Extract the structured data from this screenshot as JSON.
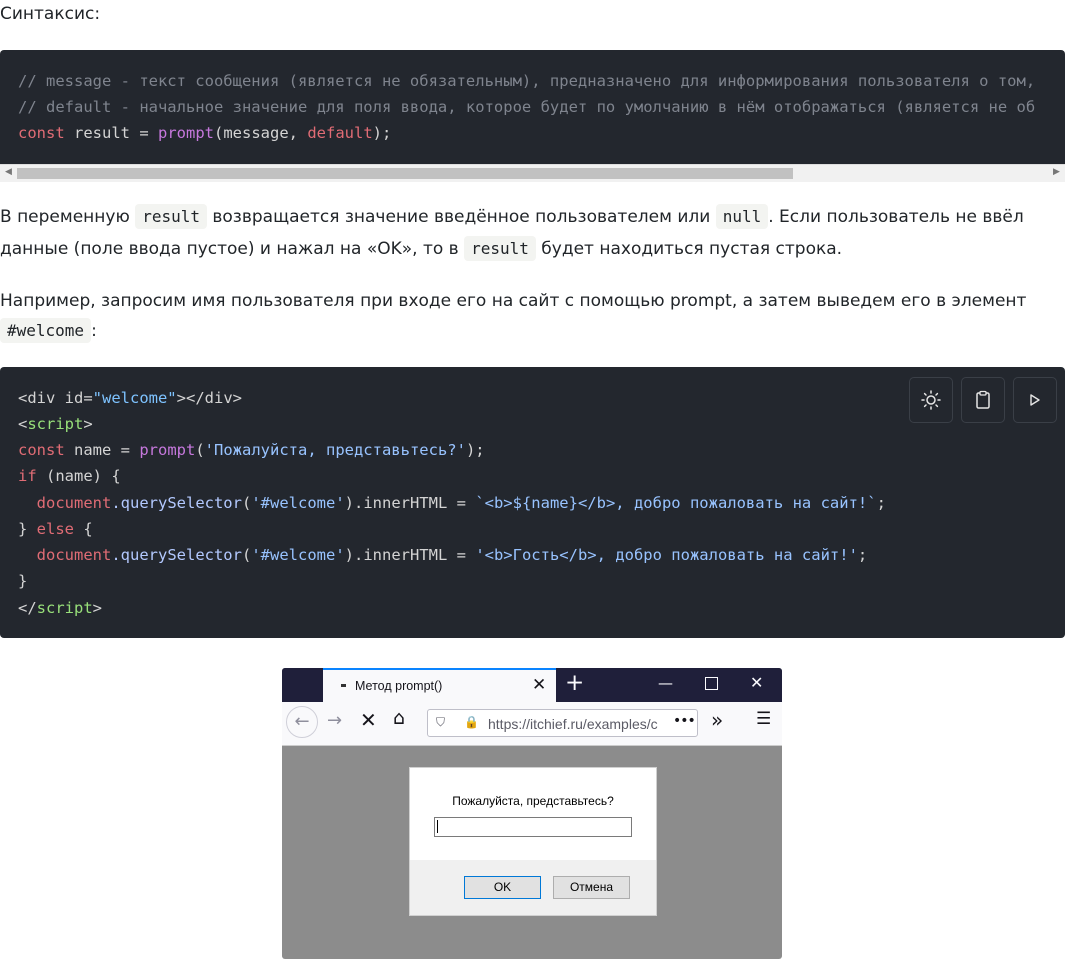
{
  "heading": "Синтаксис:",
  "code_block_1": {
    "line1": "// message - текст сообщения (является не обязательным), предназначено для информирования пользователя о том,",
    "line2": "// default - начальное значение для поля ввода, которое будет по умолчанию в нём отображаться (является не об",
    "line3": {
      "kw": "const",
      "ident": " result = ",
      "fn": "prompt",
      "open": "(message, ",
      "param": "default",
      "close": ");"
    }
  },
  "para1": {
    "t1": "В переменную ",
    "c1": "result",
    "t2": " возвращается значение введённое пользователем или ",
    "c2": "null",
    "t3": ". Если пользователь не ввёл",
    "t4": "данные (поле ввода пустое) и нажал на «OK», то в ",
    "c3": "result",
    "t5": " будет находиться пустая строка."
  },
  "para2": {
    "t1": "Например, запросим имя пользователя при входе его на сайт с помощью prompt, а затем выведем его в элемент",
    "c1": "#welcome",
    "t2": ":"
  },
  "code_block_2": {
    "l1": {
      "a": "<div id=",
      "b": "\"welcome\"",
      "c": "></div>"
    },
    "l2": {
      "a": "<",
      "b": "script",
      "c": ">"
    },
    "l3": {
      "kw": "const",
      "a": " name = ",
      "fn": "prompt",
      "b": "(",
      "str": "'Пожалуйста, представьтесь?'",
      "c": ");"
    },
    "l4": {
      "kw": "if",
      "a": " (name) {"
    },
    "l5": {
      "doc": "document",
      "m": ".querySelector",
      "a": "(",
      "str": "'#welcome'",
      "b": ").innerHTML = ",
      "tpl": "`<b>${name}</b>, добро пожаловать на сайт!`",
      "c": ";"
    },
    "l6": {
      "a": "} ",
      "kw": "else",
      "b": " {"
    },
    "l7": {
      "doc": "document",
      "m": ".querySelector",
      "a": "(",
      "str": "'#welcome'",
      "b": ").innerHTML = ",
      "str2": "'<b>Гость</b>, добро пожаловать на сайт!'",
      "c": ";"
    },
    "l8": {
      "a": "}"
    },
    "l9": {
      "a": "</",
      "b": "script",
      "c": ">"
    },
    "toolbar_icons": [
      "sun-icon",
      "clipboard-icon",
      "play-icon"
    ]
  },
  "browser": {
    "tab_title": "Метод prompt()",
    "url": "https://itchief.ru/examples/c",
    "dialog": {
      "message": "Пожалуйста, представьтесь?",
      "input_value": "",
      "ok_label": "OK",
      "cancel_label": "Отмена"
    }
  }
}
